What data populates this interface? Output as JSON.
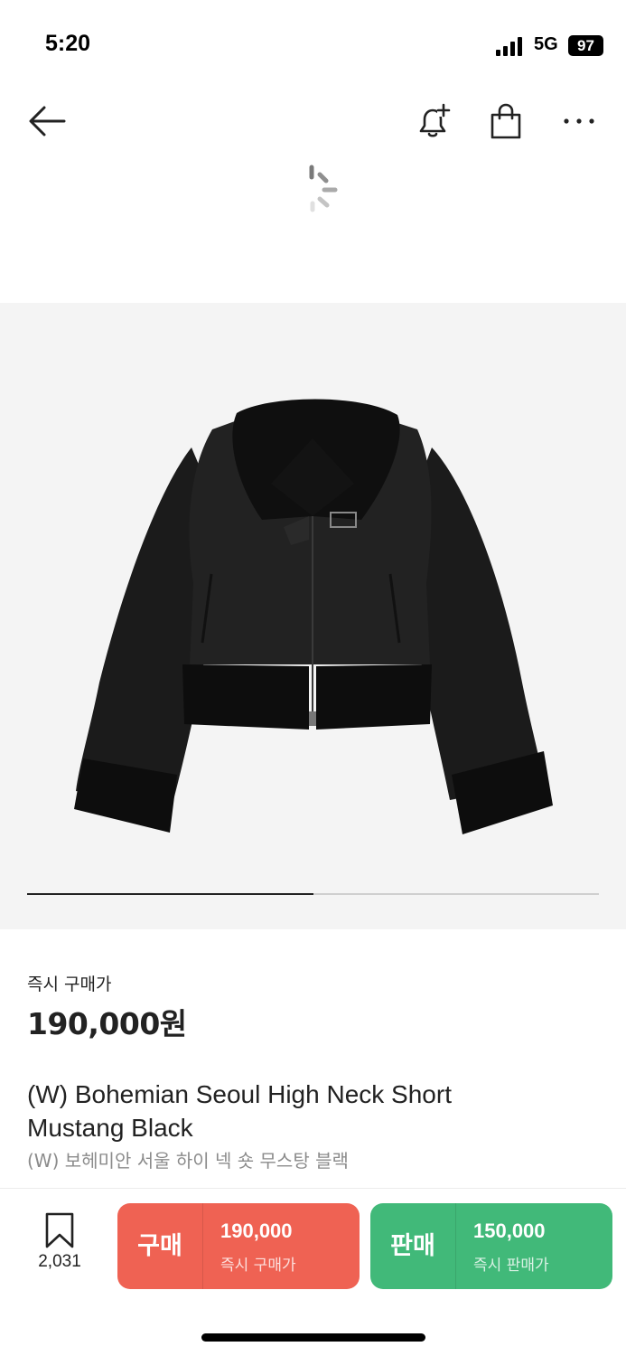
{
  "status_bar": {
    "time": "5:20",
    "network": "5G",
    "battery": "97"
  },
  "nav": {
    "back_icon": "arrow-left-icon",
    "alert_icon": "bell-plus-icon",
    "bag_icon": "shopping-bag-icon",
    "more_icon": "more-horizontal-icon"
  },
  "gallery": {
    "progress": 0.5
  },
  "product": {
    "price_label": "즉시 구매가",
    "price": "190,000원",
    "title_en": "(W) Bohemian Seoul High Neck Short Mustang Black",
    "title_ko": "(W) 보헤미안 서울 하이 넥 숏 무스탕 블랙"
  },
  "bottom": {
    "wish_count": "2,031",
    "buy": {
      "label": "구매",
      "price": "190,000",
      "sub": "즉시 구매가",
      "color": "#ef6253"
    },
    "sell": {
      "label": "판매",
      "price": "150,000",
      "sub": "즉시 판매가",
      "color": "#41b979"
    }
  }
}
